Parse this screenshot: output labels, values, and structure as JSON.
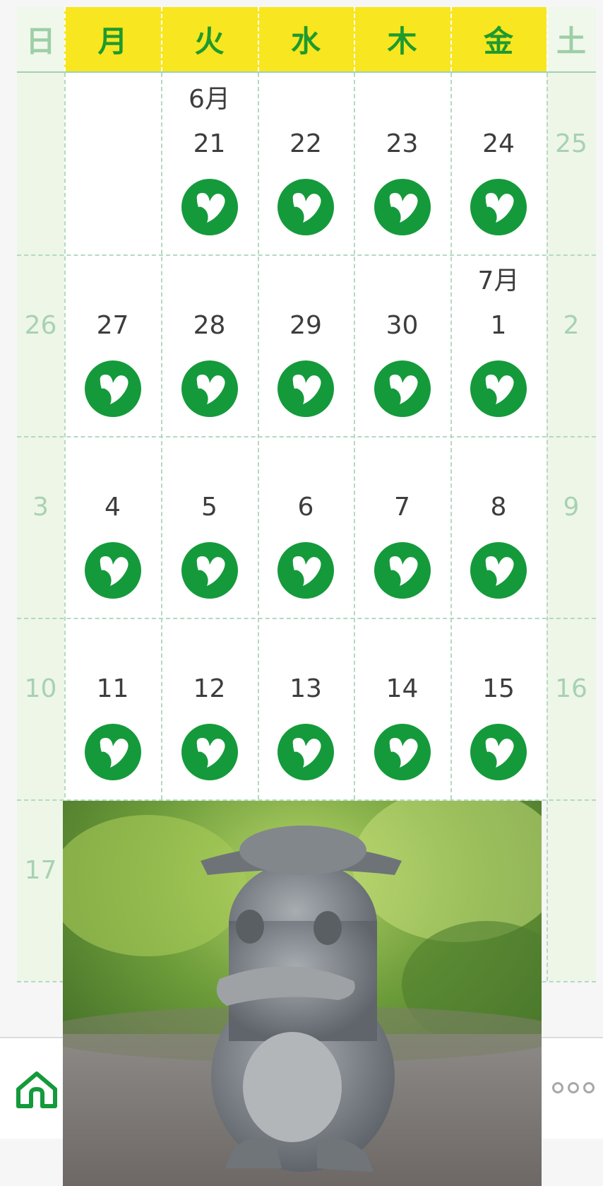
{
  "weekday_headers": [
    "日",
    "月",
    "火",
    "水",
    "木",
    "金",
    "土"
  ],
  "weeks": [
    [
      "",
      "",
      "21",
      "22",
      "23",
      "24",
      "25"
    ],
    [
      "26",
      "27",
      "28",
      "29",
      "30",
      "1",
      "2"
    ],
    [
      "3",
      "4",
      "5",
      "6",
      "7",
      "8",
      "9"
    ],
    [
      "10",
      "11",
      "12",
      "13",
      "14",
      "15",
      "16"
    ],
    [
      "17",
      "",
      "",
      "",
      "",
      "",
      ""
    ]
  ],
  "month_labels": {
    "june": "6月",
    "july": "7月"
  },
  "badge_icon": "heart-leaf-icon",
  "colors": {
    "accent_green": "#149a3b",
    "header_yellow": "#f7e620",
    "header_text_green": "#1e9a2f",
    "weekend_text": "#a7d2b2",
    "weekend_bg": "#eef6e8"
  },
  "bottom_bar": {
    "home_icon": "home-icon",
    "more_icon": "more-options-icon"
  },
  "photo": {
    "subject": "stone-bird-statue-photo"
  }
}
